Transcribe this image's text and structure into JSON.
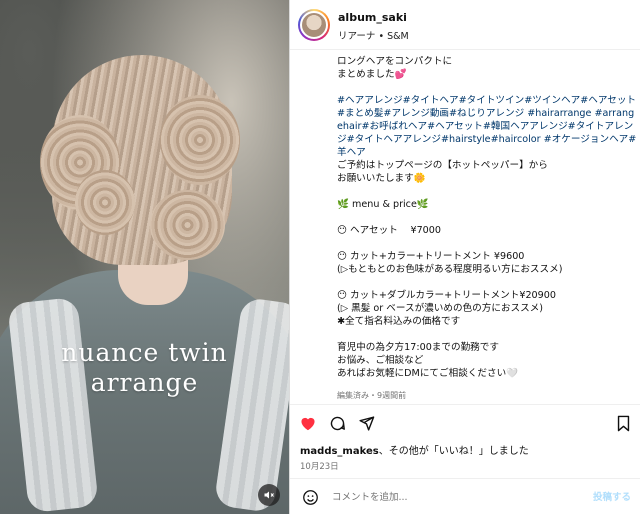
{
  "media": {
    "overlay_line1": "nuance twin",
    "overlay_line2": "arrange",
    "mute_icon": "muted-speaker-icon"
  },
  "header": {
    "username": "album_saki",
    "subtitle": "リアーナ • S&M"
  },
  "caption": {
    "intro": "ロングヘアをコンパクトに\nまとめました💕",
    "hashtags": "#ヘアアレンジ#タイトヘア#タイトツイン#ツインヘア#ヘアセット#まとめ髪#アレンジ動画#ねじりアレンジ #hairarrange #arrangehair#お呼ばれヘア#ヘアセット#韓国ヘアアレンジ#タイトアレンジ#タイトヘアアレンジ#hairstyle#haircolor #オケージョンヘア#羊ヘア",
    "body": "ご予約はトップページの【ホットペッパー】から\nお願いいたします🌼\n\n🌿 menu & price🌿\n\n😶 ヘアセット　 ¥7000\n\n😶 カット+カラー+トリートメント ¥9600\n(▷もともとのお色味がある程度明るい方におススメ)\n\n😶 カット+ダブルカラー+トリートメント¥20900\n(▷ 黒髪 or ベースが濃いめの色の方におススメ)\n✱全て指名料込みの価格です\n\n育児中の為夕方17:00までの勤務です\nお悩み、ご相談など\nあればお気軽にDMにてご相談ください🤍\n\n🌿 🌿 🌿 🌿 🌿 🌿 🌿 🌿 🌿 🌿 🌿 🌿 🌿",
    "edited": "編集済み・9週間前"
  },
  "actions": {
    "like_icon": "heart-filled-icon",
    "comment_icon": "comment-icon",
    "share_icon": "paper-plane-icon",
    "save_icon": "bookmark-icon",
    "like_color": "#ff3040"
  },
  "likes": {
    "user": "madds_makes",
    "text": "、その他が「いいね！」しました"
  },
  "date": "10月23日",
  "comment": {
    "placeholder": "コメントを追加...",
    "post_label": "投稿する",
    "emoji_icon": "smiley-icon"
  }
}
